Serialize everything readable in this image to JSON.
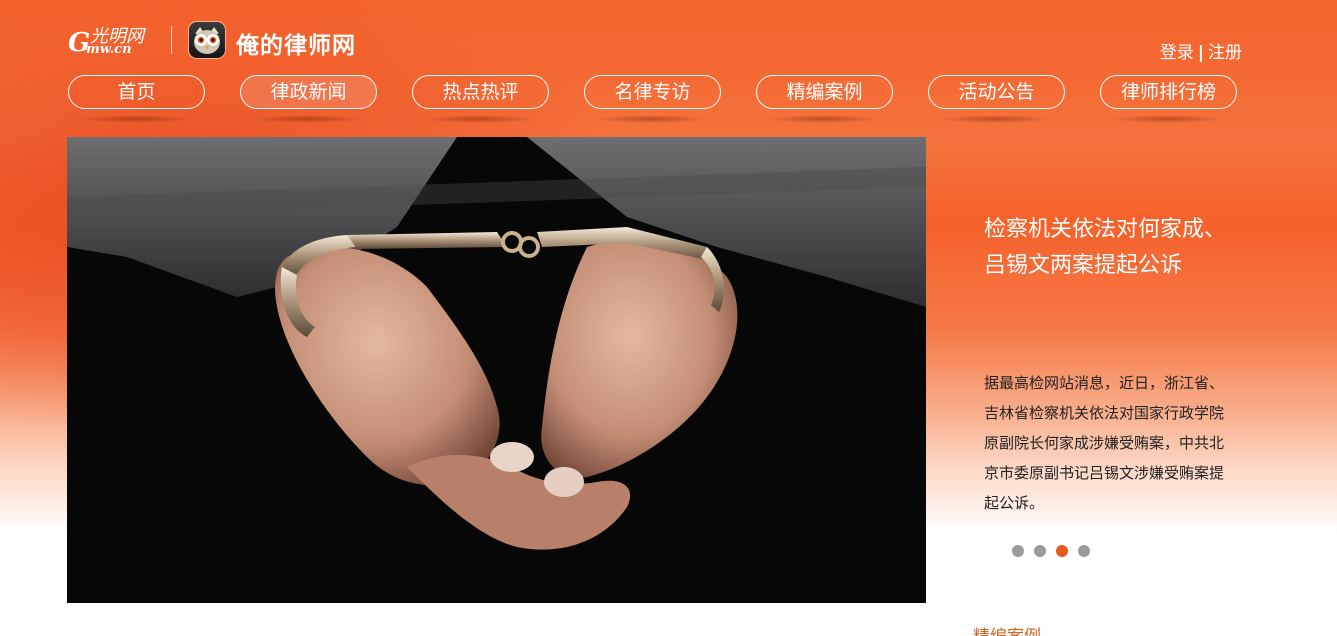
{
  "header": {
    "logo": {
      "g": "G",
      "script": "光明网",
      "domain": "mw.cn"
    },
    "site_title": "俺的律师网",
    "auth": {
      "login": "登录",
      "separator": "|",
      "register": "注册"
    }
  },
  "nav": {
    "items": [
      {
        "label": "首页",
        "active": false
      },
      {
        "label": "律政新闻",
        "active": true
      },
      {
        "label": "热点热评",
        "active": false
      },
      {
        "label": "名律专访",
        "active": false
      },
      {
        "label": "精编案例",
        "active": false
      },
      {
        "label": "活动公告",
        "active": false
      },
      {
        "label": "律师排行榜",
        "active": false
      }
    ]
  },
  "hero": {
    "image_icon": "handcuffed-hands-photo",
    "title": "检察机关依法对何家成、吕锡文两案提起公诉",
    "summary": "据最高检网站消息，近日，浙江省、吉林省检察机关依法对国家行政学院原副院长何家成涉嫌受贿案，中共北京市委原副书记吕锡文涉嫌受贿案提起公诉。",
    "slides": 4,
    "active_slide": 3
  },
  "next_section": {
    "label": "精编案例"
  },
  "colors": {
    "brand_orange": "#f4632c",
    "accent": "#e45a1c",
    "dot_inactive": "#9a9a9a",
    "section_label": "#d5631f"
  }
}
